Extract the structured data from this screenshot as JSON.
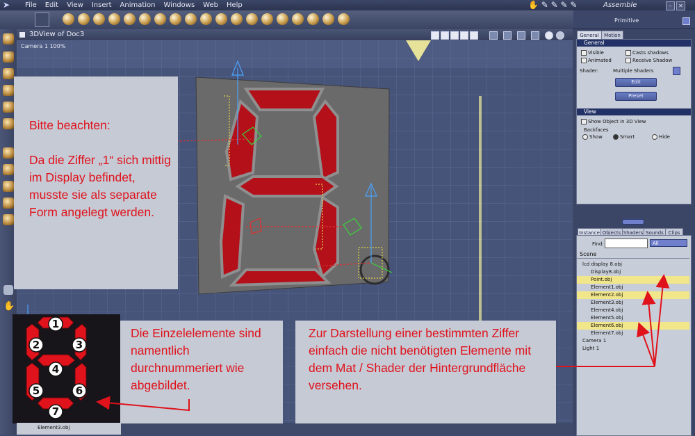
{
  "app": {
    "menu": [
      "File",
      "Edit",
      "View",
      "Insert",
      "Animation",
      "Windows",
      "Web",
      "Help"
    ],
    "room": "Assemble"
  },
  "viewport": {
    "title": "3DView of Doc3",
    "camera": "Camera 1 100%"
  },
  "right_panel": {
    "header": "Primitive",
    "tabs": [
      "General",
      "Motion"
    ],
    "general": {
      "title": "General",
      "visible": "Visible",
      "animated": "Animated",
      "casts_shadows": "Casts shadows",
      "receive_shadow": "Receive Shadow",
      "shader_label": "Shader:",
      "shader_value": "Multiple Shaders",
      "edit_btn": "Edit",
      "preset_btn": "Preset"
    },
    "view": {
      "title": "View",
      "show_in_3d": "Show Object in 3D View",
      "backfaces": "Backfaces",
      "show": "Show",
      "smart": "Smart",
      "hide": "Hide"
    }
  },
  "browser": {
    "tabs": [
      "Instance",
      "Objects",
      "Shaders",
      "Sounds",
      "Clips"
    ],
    "find_label": "Find:",
    "filter": "All",
    "scene": "Scene",
    "rows": [
      {
        "label": "lcd display 8.obj",
        "hl": false,
        "indent": 1
      },
      {
        "label": "Display8.obj",
        "hl": false,
        "indent": 2
      },
      {
        "label": "Point.obj",
        "hl": true,
        "indent": 2
      },
      {
        "label": "Element1.obj",
        "hl": false,
        "indent": 2
      },
      {
        "label": "Element2.obj",
        "hl": true,
        "indent": 2
      },
      {
        "label": "Element3.obj",
        "hl": false,
        "indent": 2
      },
      {
        "label": "Element4.obj",
        "hl": false,
        "indent": 2
      },
      {
        "label": "Element5.obj",
        "hl": false,
        "indent": 2
      },
      {
        "label": "Element6.obj",
        "hl": true,
        "indent": 2
      },
      {
        "label": "Element7.obj",
        "hl": false,
        "indent": 2
      },
      {
        "label": "Camera 1",
        "hl": false,
        "indent": 1
      },
      {
        "label": "Light 1",
        "hl": false,
        "indent": 1
      }
    ]
  },
  "notes": {
    "note1": "Bitte beachten:\n\nDa die Ziffer „1“ sich mittig im Display befindet, musste sie als separate Form angelegt werden.",
    "note2": "Die Einzelelemente sind namentlich durchnummeriert wie abgebildet.",
    "note3": "Zur Darstellung einer bestimmten Ziffer einfach die nicht benötigten Elemente mit dem Mat / Shader der Hintergrundfläche versehen."
  },
  "digit_labels": [
    "1",
    "2",
    "3",
    "4",
    "5",
    "6",
    "7"
  ],
  "bottom": {
    "selected": "Element3.obj"
  },
  "colors": {
    "accent_red": "#e0121b",
    "segment_red": "#b3101a",
    "panel_bg": "#c8ced9",
    "highlight": "#f2e68a"
  }
}
